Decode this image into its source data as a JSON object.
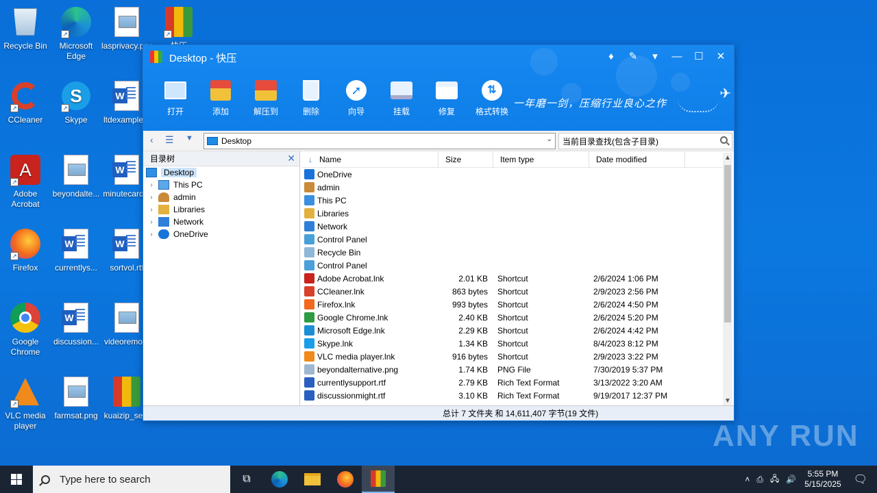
{
  "desktop": {
    "icons": [
      {
        "label": "Recycle Bin"
      },
      {
        "label": "Microsoft Edge"
      },
      {
        "label": "lasprivacy.png"
      },
      {
        "label": "快压"
      },
      {
        "label": "CCleaner"
      },
      {
        "label": "Skype"
      },
      {
        "label": "ltdexample..."
      },
      {
        "label": "Adobe Acrobat"
      },
      {
        "label": "beyondalte..."
      },
      {
        "label": "minutecard..."
      },
      {
        "label": "Firefox"
      },
      {
        "label": "currentlys..."
      },
      {
        "label": "sortvol.rtf"
      },
      {
        "label": "Google Chrome"
      },
      {
        "label": "discussion..."
      },
      {
        "label": "videoremo..."
      },
      {
        "label": "VLC media player"
      },
      {
        "label": "farmsat.png"
      },
      {
        "label": "kuaizip_se..."
      }
    ]
  },
  "window": {
    "title": "Desktop - 快压",
    "toolbar": [
      {
        "label": "打开",
        "icon": "open-folder-icon"
      },
      {
        "label": "添加",
        "icon": "add-archive-icon"
      },
      {
        "label": "解压到",
        "icon": "extract-icon"
      },
      {
        "label": "删除",
        "icon": "delete-icon"
      },
      {
        "label": "向导",
        "icon": "wizard-icon"
      },
      {
        "label": "挂载",
        "icon": "mount-icon"
      },
      {
        "label": "修复",
        "icon": "repair-icon"
      },
      {
        "label": "格式转换",
        "icon": "convert-icon"
      }
    ],
    "slogan": "一年磨一剑，压缩行业良心之作",
    "address": "Desktop",
    "search_placeholder": "当前目录查找(包含子目录)",
    "tree": {
      "title": "目录树",
      "items": [
        {
          "label": "Desktop",
          "selected": true
        },
        {
          "label": "This PC"
        },
        {
          "label": "admin"
        },
        {
          "label": "Libraries"
        },
        {
          "label": "Network"
        },
        {
          "label": "OneDrive"
        }
      ]
    },
    "columns": [
      "Name",
      "Size",
      "Item type",
      "Date modified"
    ],
    "files": [
      {
        "name": "OneDrive",
        "size": "",
        "type": "",
        "date": "",
        "color": "#1a73d9"
      },
      {
        "name": "admin",
        "size": "",
        "type": "",
        "date": "",
        "color": "#c98a3a"
      },
      {
        "name": "This PC",
        "size": "",
        "type": "",
        "date": "",
        "color": "#3b8fe0"
      },
      {
        "name": "Libraries",
        "size": "",
        "type": "",
        "date": "",
        "color": "#e3b13f"
      },
      {
        "name": "Network",
        "size": "",
        "type": "",
        "date": "",
        "color": "#2f7fd8"
      },
      {
        "name": "Control Panel",
        "size": "",
        "type": "",
        "date": "",
        "color": "#4aa0d8"
      },
      {
        "name": "Recycle Bin",
        "size": "",
        "type": "",
        "date": "",
        "color": "#8fb7d8"
      },
      {
        "name": "Control Panel",
        "size": "",
        "type": "",
        "date": "",
        "color": "#4aa0d8"
      },
      {
        "name": "Adobe Acrobat.lnk",
        "size": "2.01 KB",
        "type": "Shortcut",
        "date": "2/6/2024 1:06 PM",
        "color": "#c8231c"
      },
      {
        "name": "CCleaner.lnk",
        "size": "863 bytes",
        "type": "Shortcut",
        "date": "2/9/2023 2:56 PM",
        "color": "#d8402a"
      },
      {
        "name": "Firefox.lnk",
        "size": "993 bytes",
        "type": "Shortcut",
        "date": "2/6/2024 4:50 PM",
        "color": "#f2681c"
      },
      {
        "name": "Google Chrome.lnk",
        "size": "2.40 KB",
        "type": "Shortcut",
        "date": "2/6/2024 5:20 PM",
        "color": "#2e9b44"
      },
      {
        "name": "Microsoft Edge.lnk",
        "size": "2.29 KB",
        "type": "Shortcut",
        "date": "2/6/2024 4:42 PM",
        "color": "#1b8fd6"
      },
      {
        "name": "Skype.lnk",
        "size": "1.34 KB",
        "type": "Shortcut",
        "date": "8/4/2023 8:12 PM",
        "color": "#1a9ee8"
      },
      {
        "name": "VLC media player.lnk",
        "size": "916 bytes",
        "type": "Shortcut",
        "date": "2/9/2023 3:22 PM",
        "color": "#f08a1a"
      },
      {
        "name": "beyondalternative.png",
        "size": "1.74 KB",
        "type": "PNG File",
        "date": "7/30/2019 5:37 PM",
        "color": "#9fb8cf"
      },
      {
        "name": "currentlysupport.rtf",
        "size": "2.79 KB",
        "type": "Rich Text Format",
        "date": "3/13/2022 3:20 AM",
        "color": "#2a5fbf"
      },
      {
        "name": "discussionmight.rtf",
        "size": "3.10 KB",
        "type": "Rich Text Format",
        "date": "9/19/2017 12:37 PM",
        "color": "#2a5fbf"
      }
    ],
    "status": "总计 7 文件夹 和 14,611,407 字节(19 文件)"
  },
  "taskbar": {
    "search_placeholder": "Type here to search",
    "time": "5:55 PM",
    "date": "5/15/2025"
  },
  "watermark": "ANY RUN"
}
